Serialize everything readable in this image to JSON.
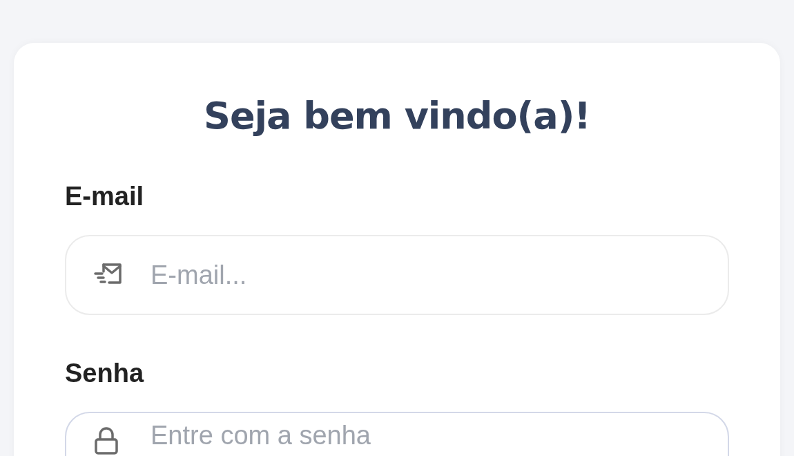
{
  "title": "Seja bem vindo(a)!",
  "fields": [
    {
      "kind": "email",
      "label": "E-mail",
      "placeholder": "E-mail...",
      "focused": false
    },
    {
      "kind": "password",
      "label": "Senha",
      "placeholder": "Entre com a senha",
      "focused": true
    }
  ]
}
